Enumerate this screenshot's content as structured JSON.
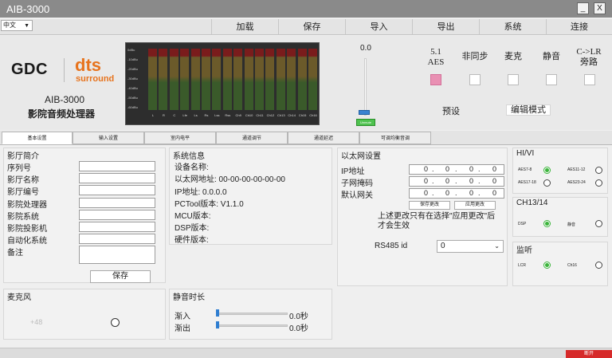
{
  "window": {
    "title": "AIB-3000",
    "minimize_label": "_",
    "close_label": "X"
  },
  "language": {
    "selected": "中文"
  },
  "menu": [
    {
      "label": "加载"
    },
    {
      "label": "保存"
    },
    {
      "label": "导入"
    },
    {
      "label": "导出"
    },
    {
      "label": "系统"
    },
    {
      "label": "连接"
    }
  ],
  "header": {
    "brand_gdc": "GDC",
    "brand_dts": "dts",
    "brand_surround": "surround",
    "product_name": "AIB-3000",
    "product_subtitle": "影院音频处理器"
  },
  "meter": {
    "scale": [
      "0dBu",
      "-10dBu",
      "-20dBu",
      "-30dBu",
      "-40dBu",
      "-50dBu",
      "-60dBu"
    ],
    "channels": [
      "L",
      "R",
      "C",
      "Lfe",
      "Ls",
      "Rs",
      "Lss",
      "Rss",
      "Ch9",
      "Ch10",
      "Ch11",
      "Ch12",
      "Ch13",
      "Ch14",
      "Ch15",
      "Ch16"
    ],
    "colors": {
      "top": "#7a1c1c",
      "mid": "#6b5a2a",
      "low": "#3a5a2a"
    }
  },
  "fader": {
    "value": "0.0",
    "button_label": "Unmute",
    "level": 0.1
  },
  "sources": [
    {
      "label": "5.1\nAES",
      "active": true
    },
    {
      "label": "非同步",
      "active": false
    },
    {
      "label": "麦克",
      "active": false
    },
    {
      "label": "静音",
      "active": false
    },
    {
      "label": "C->LR\n旁路",
      "active": false
    }
  ],
  "preset_label": "预设",
  "edit_mode_label": "编辑模式",
  "tabs": [
    {
      "label": "基本设置",
      "active": true
    },
    {
      "label": "输入设置",
      "active": false
    },
    {
      "label": "室内电平",
      "active": false
    },
    {
      "label": "通道调节",
      "active": false
    },
    {
      "label": "通道延迟",
      "active": false
    },
    {
      "label": "可调均衡音调",
      "active": false
    }
  ],
  "cinema_info": {
    "title": "影厅简介",
    "fields": [
      {
        "label": "序列号",
        "value": ""
      },
      {
        "label": "影厅名称",
        "value": ""
      },
      {
        "label": "影厅编号",
        "value": ""
      },
      {
        "label": "影院处理器",
        "value": ""
      },
      {
        "label": "影院系统",
        "value": ""
      },
      {
        "label": "影院投影机",
        "value": ""
      },
      {
        "label": "自动化系统",
        "value": ""
      },
      {
        "label": "备注",
        "value": ""
      }
    ],
    "save_label": "保存"
  },
  "system_info": {
    "title": "系统信息",
    "lines": [
      "设备名称:",
      "以太网地址: 00-00-00-00-00-00",
      "IP地址: 0.0.0.0",
      "PCTool版本: V1.1.0",
      "MCU版本:",
      "DSP版本:",
      "硬件版本:"
    ]
  },
  "ethernet": {
    "title": "以太网设置",
    "ip_label": "IP地址",
    "mask_label": "子网掩码",
    "gateway_label": "默认网关",
    "octets": [
      "0",
      "0",
      "0",
      "0"
    ],
    "save_changes_label": "保存更改",
    "apply_changes_label": "应用更改",
    "note": "上述更改只有在选择\"应用更改\"后才会生效",
    "rs485_label": "RS485 id",
    "rs485_value": "0"
  },
  "hivi": {
    "title": "HI/VI",
    "options": [
      {
        "label": "AES7-8",
        "on": true
      },
      {
        "label": "AES11-12",
        "on": false
      },
      {
        "label": "AES17-18",
        "on": false
      },
      {
        "label": "AES23-24",
        "on": false
      }
    ]
  },
  "ch1314": {
    "title": "CH13/14",
    "options": [
      {
        "label": "DSP",
        "on": true
      },
      {
        "label": "静音",
        "on": false
      }
    ]
  },
  "monitor": {
    "title": "监听",
    "options": [
      {
        "label": "LCR",
        "on": true
      },
      {
        "label": "Ch16",
        "on": false
      }
    ]
  },
  "mic": {
    "title": "麦克风",
    "phantom_label": "+48"
  },
  "mute_time": {
    "title": "静音时长",
    "fade_in_label": "渐入",
    "fade_in_value": "0.0秒",
    "fade_out_label": "渐出",
    "fade_out_value": "0.0秒"
  },
  "status": {
    "connection": "断开"
  }
}
